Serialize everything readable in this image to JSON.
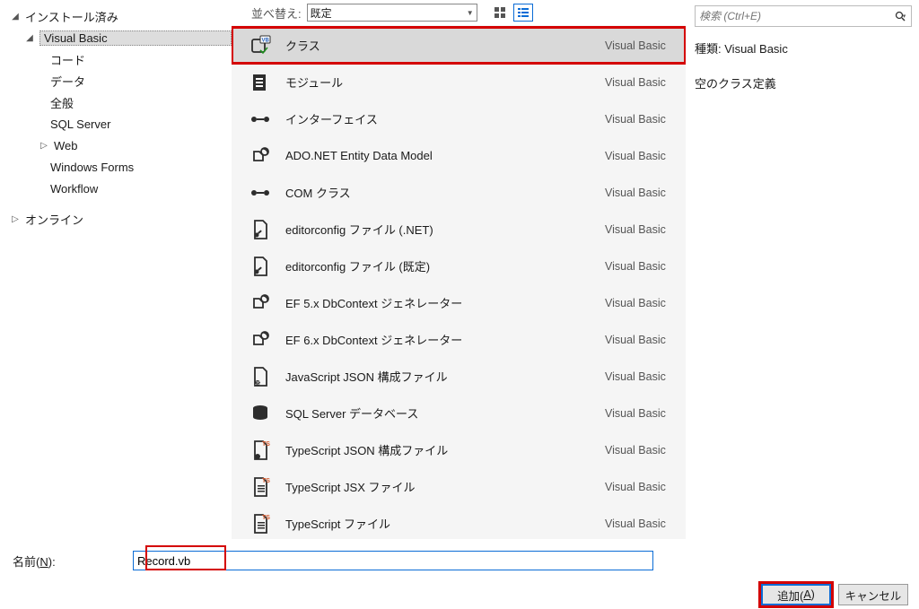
{
  "tree": {
    "installed": "インストール済み",
    "visual_basic": "Visual Basic",
    "code": "コード",
    "data_node": "データ",
    "general": "全般",
    "sql_server": "SQL Server",
    "web": "Web",
    "windows_forms": "Windows Forms",
    "workflow": "Workflow",
    "online": "オンライン"
  },
  "sort": {
    "label": "並べ替え:",
    "value": "既定"
  },
  "templates": [
    {
      "title": "クラス",
      "lang": "Visual Basic",
      "icon": "class-vb"
    },
    {
      "title": "モジュール",
      "lang": "Visual Basic",
      "icon": "module"
    },
    {
      "title": "インターフェイス",
      "lang": "Visual Basic",
      "icon": "interface"
    },
    {
      "title": "ADO.NET Entity Data Model",
      "lang": "Visual Basic",
      "icon": "entity"
    },
    {
      "title": "COM クラス",
      "lang": "Visual Basic",
      "icon": "interface"
    },
    {
      "title": "editorconfig ファイル (.NET)",
      "lang": "Visual Basic",
      "icon": "file-wrench"
    },
    {
      "title": "editorconfig ファイル (既定)",
      "lang": "Visual Basic",
      "icon": "file-wrench"
    },
    {
      "title": "EF 5.x DbContext ジェネレーター",
      "lang": "Visual Basic",
      "icon": "entity"
    },
    {
      "title": "EF 6.x DbContext ジェネレーター",
      "lang": "Visual Basic",
      "icon": "entity"
    },
    {
      "title": "JavaScript JSON 構成ファイル",
      "lang": "Visual Basic",
      "icon": "file-js"
    },
    {
      "title": "SQL Server データベース",
      "lang": "Visual Basic",
      "icon": "database"
    },
    {
      "title": "TypeScript JSON 構成ファイル",
      "lang": "Visual Basic",
      "icon": "file-ts"
    },
    {
      "title": "TypeScript JSX ファイル",
      "lang": "Visual Basic",
      "icon": "file-ts-lines"
    },
    {
      "title": "TypeScript ファイル",
      "lang": "Visual Basic",
      "icon": "file-ts-lines"
    }
  ],
  "search": {
    "placeholder": "検索 (Ctrl+E)"
  },
  "info": {
    "type_label": "種類:",
    "type_value": "Visual Basic",
    "desc": "空のクラス定義"
  },
  "bottom": {
    "name_label": "名前(",
    "name_key": "N",
    "name_label_after": "):",
    "name_value": "Record.vb",
    "add_label": "追加(",
    "add_key": "A",
    "add_label_after": ")",
    "cancel_label": "キャンセル"
  }
}
